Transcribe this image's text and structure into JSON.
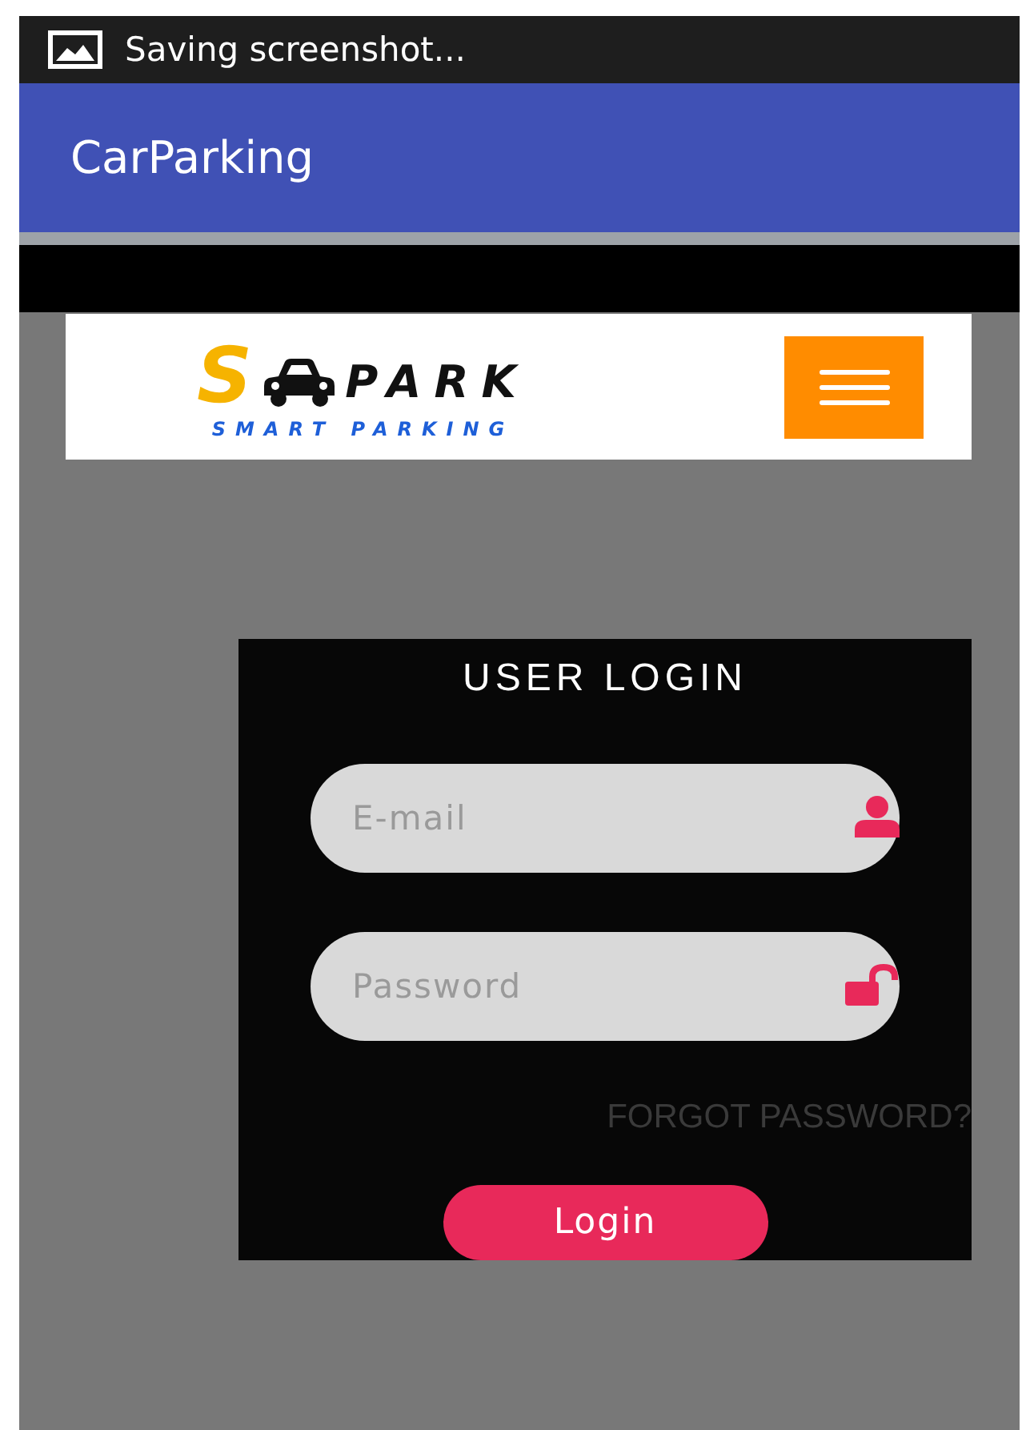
{
  "status_bar": {
    "notification": "Saving screenshot..."
  },
  "app_bar": {
    "title": "CarParking"
  },
  "logo": {
    "letter": "S",
    "word": "PARK",
    "tagline": "SMART PARKING"
  },
  "login": {
    "title": "USER LOGIN",
    "fields": [
      {
        "kind": "email",
        "placeholder": "E-mail"
      },
      {
        "kind": "password",
        "placeholder": "Password"
      }
    ],
    "forgot_link": "FORGOT PASSWORD?",
    "button": "Login"
  }
}
